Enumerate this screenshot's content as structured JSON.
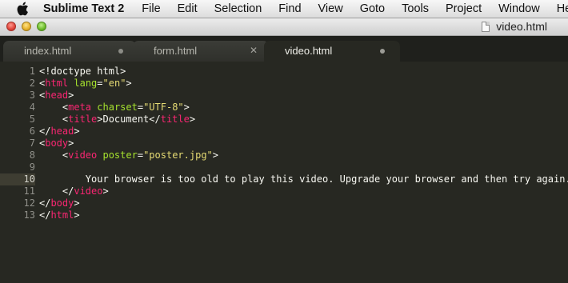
{
  "menubar": {
    "apple_icon": "apple-icon",
    "app_name": "Sublime Text 2",
    "items": [
      "File",
      "Edit",
      "Selection",
      "Find",
      "View",
      "Goto",
      "Tools",
      "Project",
      "Window",
      "Help"
    ]
  },
  "titlebar": {
    "title": "video.html",
    "file_icon": "document-icon"
  },
  "tabs": [
    {
      "label": "index.html",
      "state": "modified"
    },
    {
      "label": "form.html",
      "state": "close"
    },
    {
      "label": "video.html",
      "state": "modified",
      "active": true
    }
  ],
  "editor": {
    "current_line": 10,
    "lines": [
      {
        "num": "1",
        "tokens": [
          {
            "t": "plain",
            "v": "<!doctype html>"
          }
        ]
      },
      {
        "num": "2",
        "tokens": [
          {
            "t": "plain",
            "v": "<"
          },
          {
            "t": "tag",
            "v": "html"
          },
          {
            "t": "plain",
            "v": " "
          },
          {
            "t": "attr",
            "v": "lang"
          },
          {
            "t": "plain",
            "v": "="
          },
          {
            "t": "str",
            "v": "\"en\""
          },
          {
            "t": "plain",
            "v": ">"
          }
        ]
      },
      {
        "num": "3",
        "tokens": [
          {
            "t": "plain",
            "v": "<"
          },
          {
            "t": "tag",
            "v": "head"
          },
          {
            "t": "plain",
            "v": ">"
          }
        ]
      },
      {
        "num": "4",
        "tokens": [
          {
            "t": "plain",
            "v": "    <"
          },
          {
            "t": "tag",
            "v": "meta"
          },
          {
            "t": "plain",
            "v": " "
          },
          {
            "t": "attr",
            "v": "charset"
          },
          {
            "t": "plain",
            "v": "="
          },
          {
            "t": "str",
            "v": "\"UTF-8\""
          },
          {
            "t": "plain",
            "v": ">"
          }
        ]
      },
      {
        "num": "5",
        "tokens": [
          {
            "t": "plain",
            "v": "    <"
          },
          {
            "t": "tag",
            "v": "title"
          },
          {
            "t": "plain",
            "v": ">Document</"
          },
          {
            "t": "tag",
            "v": "title"
          },
          {
            "t": "plain",
            "v": ">"
          }
        ]
      },
      {
        "num": "6",
        "tokens": [
          {
            "t": "plain",
            "v": "</"
          },
          {
            "t": "tag",
            "v": "head"
          },
          {
            "t": "plain",
            "v": ">"
          }
        ]
      },
      {
        "num": "7",
        "tokens": [
          {
            "t": "plain",
            "v": "<"
          },
          {
            "t": "tag",
            "v": "body"
          },
          {
            "t": "plain",
            "v": ">"
          }
        ]
      },
      {
        "num": "8",
        "tokens": [
          {
            "t": "plain",
            "v": "    <"
          },
          {
            "t": "tag",
            "v": "video"
          },
          {
            "t": "plain",
            "v": " "
          },
          {
            "t": "attr",
            "v": "poster"
          },
          {
            "t": "plain",
            "v": "="
          },
          {
            "t": "str",
            "v": "\"poster.jpg\""
          },
          {
            "t": "plain",
            "v": ">"
          }
        ]
      },
      {
        "num": "9",
        "tokens": []
      },
      {
        "num": "10",
        "tokens": [
          {
            "t": "plain",
            "v": "        Your browser is too old to play this video. Upgrade your browser and then try again."
          }
        ]
      },
      {
        "num": "11",
        "tokens": [
          {
            "t": "plain",
            "v": "    </"
          },
          {
            "t": "tag",
            "v": "video"
          },
          {
            "t": "plain",
            "v": ">"
          }
        ]
      },
      {
        "num": "12",
        "tokens": [
          {
            "t": "plain",
            "v": "</"
          },
          {
            "t": "tag",
            "v": "body"
          },
          {
            "t": "plain",
            "v": ">"
          }
        ]
      },
      {
        "num": "13",
        "tokens": [
          {
            "t": "plain",
            "v": "</"
          },
          {
            "t": "tag",
            "v": "html"
          },
          {
            "t": "plain",
            "v": ">"
          }
        ]
      }
    ]
  },
  "theme": {
    "background": "#272822",
    "tag": "#f92672",
    "attr": "#a6e22e",
    "string": "#e6db74",
    "text": "#f8f8f2"
  }
}
